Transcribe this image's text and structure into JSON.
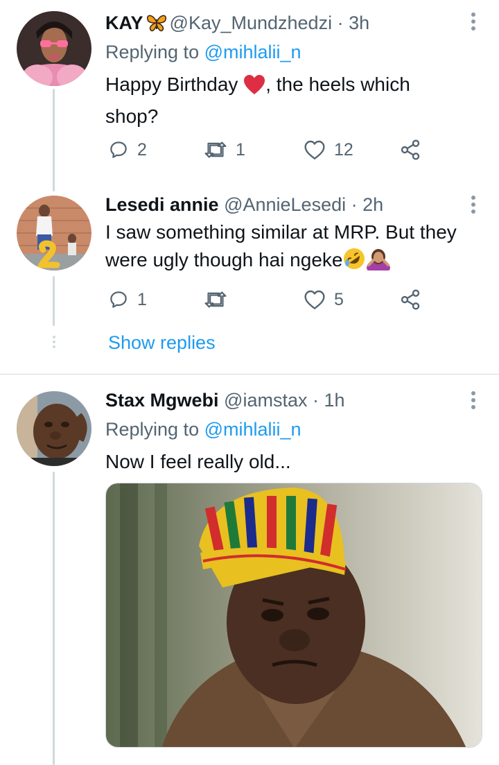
{
  "tweets": [
    {
      "name": "KAY",
      "handle": "@Kay_Mundzhedzi",
      "time": "3h",
      "replying_prefix": "Replying to",
      "replying_to": "@mihlalii_n",
      "text_part1": "Happy Birthday",
      "text_part2": ", the heels which shop?",
      "replies": "2",
      "retweets": "1",
      "likes": "12",
      "avatar_icon": "kay-avatar",
      "badge_icon": "butterfly-emoji",
      "emoji": "red-heart-emoji"
    },
    {
      "name": "Lesedi annie",
      "handle": "@AnnieLesedi",
      "time": "2h",
      "text": "I saw something similar at MRP. But they were ugly though hai ngeke",
      "replies": "1",
      "retweets": "",
      "likes": "5",
      "avatar_icon": "lesedi-avatar",
      "emojis": [
        "rolling-on-floor-laughing-emoji",
        "person-gesturing-no-emoji"
      ]
    },
    {
      "name": "Stax Mgwebi",
      "handle": "@iamstax",
      "time": "1h",
      "replying_prefix": "Replying to",
      "replying_to": "@mihlalii_n",
      "text": "Now I feel really old...",
      "avatar_icon": "stax-avatar",
      "media_icon": "reaction-gif-man-kente-hat"
    }
  ],
  "show_replies_label": "Show replies",
  "separator": "·",
  "colors": {
    "accent": "#1d9bf0",
    "text": "#0f1419",
    "muted": "#536471",
    "border": "#cfd9de",
    "heart": "#e0245e"
  }
}
